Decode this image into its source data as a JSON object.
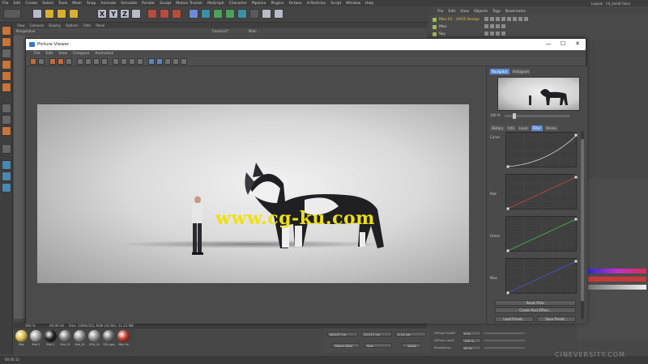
{
  "main_menu": [
    "File",
    "Edit",
    "Create",
    "Select",
    "Tools",
    "Mesh",
    "Snap",
    "Animate",
    "Simulate",
    "Render",
    "Sculpt",
    "Motion Tracker",
    "MoGraph",
    "Character",
    "Pipeline",
    "Plugins",
    "Octane",
    "X-Particles",
    "Script",
    "Window",
    "Help"
  ],
  "layout_label": "Layout:",
  "layout_value": "C4_imhdl (Ses)",
  "viewport": {
    "menu": [
      "View",
      "Cameras",
      "Display",
      "Options",
      "Filter",
      "Panel"
    ],
    "name": "Perspective",
    "camera": "Camera1*",
    "main": "Main"
  },
  "objects_manager": {
    "menu": [
      "File",
      "Edit",
      "View",
      "Objects",
      "Tags",
      "Bookmarks"
    ],
    "rows": [
      {
        "label": "Man 01 - AXYZ Design",
        "selected": true
      },
      {
        "label": "Man",
        "selected": false
      },
      {
        "label": "Sky",
        "selected": false
      }
    ]
  },
  "picture_viewer": {
    "title": "Picture Viewer",
    "minimize": "—",
    "maximize": "☐",
    "close": "✕",
    "menu": [
      "File",
      "Edit",
      "View",
      "Compare",
      "Animation"
    ],
    "watermark": "www.cg-ku.com",
    "side_tabs": [
      "Navigator",
      "Histogram"
    ],
    "zoom": "100 %",
    "filter_tabs": [
      "History",
      "Info",
      "Layer",
      "Filter",
      "Stereo"
    ],
    "active_filter_tab": "Filter",
    "curves": [
      {
        "label": "Curve",
        "color": "#e0e0e0"
      },
      {
        "label": "Red",
        "color": "#c84a3e"
      },
      {
        "label": "Green",
        "color": "#3fbf4a"
      },
      {
        "label": "Blue",
        "color": "#4a56d8"
      }
    ],
    "buttons": {
      "reset_filter": "Reset Filter",
      "create_post_effect": "Create Post Effect...",
      "load_preset": "Load Preset...",
      "save_preset": "Save Preset..."
    }
  },
  "bottom": {
    "zoom": "100 %",
    "frame": "00:00:16",
    "size_info": "Size: 1280x535, RGB (32 Bit), 11.23 MB",
    "materials": [
      {
        "name": "Mat",
        "color": "#d8b848"
      },
      {
        "name": "Mat.1",
        "color": "#9a9a9a"
      },
      {
        "name": "Mat.2",
        "color": "#222222"
      },
      {
        "name": "Mat_St",
        "color": "#7a7a7a"
      },
      {
        "name": "Mat_St",
        "color": "#8a8a8a"
      },
      {
        "name": "MYA_St",
        "color": "#8a8a8a"
      },
      {
        "name": "SOL.gse",
        "color": "#6e6e6e"
      },
      {
        "name": "Mat.Go",
        "color": "#c03a2a"
      }
    ],
    "coords": {
      "x": "46.507 cm",
      "y": "13.317 cm",
      "z": "0.14 cm",
      "mode": "Object (Rel)",
      "size": "Size",
      "apply": "Apply"
    },
    "attr_labels": [
      "Diffuse Falloff",
      "Diffuse Level",
      "Roughness"
    ],
    "attr_values": [
      "0 %",
      "100 %",
      "50 %"
    ]
  },
  "status": "00:00:12",
  "brand_watermark": "CINEVERSITY.COM"
}
